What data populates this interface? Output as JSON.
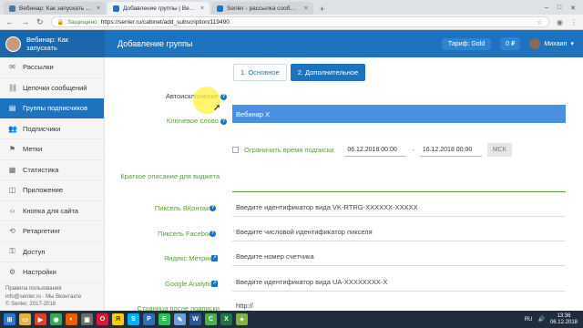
{
  "browser": {
    "tabs": [
      {
        "title": "Вебинар: Как запускать приб...",
        "color": "#1e73be"
      },
      {
        "title": "Добавление группы | Вебина...",
        "color": "#1e73be"
      },
      {
        "title": "Senler - рассылка сообщений",
        "color": "#1e73be"
      }
    ],
    "url": "https://senler.ru/cabinet/add_subscription/119490",
    "url_secure_label": "Защищено"
  },
  "header": {
    "brand_name": "Вебинар: Как запускать",
    "page_title": "Добавление группы",
    "tariff": "Тариф: Gold",
    "balance": "0 ₽",
    "user_name": "Михаил"
  },
  "sidebar": {
    "items": [
      {
        "label": "Рассылки",
        "icon": "mail-icon"
      },
      {
        "label": "Цепочки сообщений",
        "icon": "chain-icon"
      },
      {
        "label": "Группы подписчиков",
        "icon": "folder-icon"
      },
      {
        "label": "Подписчики",
        "icon": "users-icon"
      },
      {
        "label": "Метки",
        "icon": "tag-icon"
      },
      {
        "label": "Статистика",
        "icon": "stats-icon"
      },
      {
        "label": "Приложение",
        "icon": "app-icon"
      },
      {
        "label": "Кнопка для сайта",
        "icon": "code-icon"
      },
      {
        "label": "Ретаргетинг",
        "icon": "retarget-icon"
      },
      {
        "label": "Доступ",
        "icon": "access-icon"
      },
      {
        "label": "Настройки",
        "icon": "gear-icon"
      }
    ],
    "active_index": 2,
    "footer_rules": "Правила пользования",
    "footer_contacts": "info@senler.ru · Мы Вконтакте",
    "footer_copy": "© Senler, 2017-2018"
  },
  "form": {
    "tab_basic": "1. Основное",
    "tab_extra": "2. Дополнительное",
    "auto_exclude_label": "Автоисключение",
    "keyword_label": "Ключевое слово",
    "keyword_value": "Вебинар X",
    "limit_time_label": "Ограничить время подписки",
    "date_from": "06.12.2018 00:00",
    "date_to": "16.12.2018 00:00",
    "timezone": "МСК",
    "short_desc_label": "Краткое описание для виджета",
    "vk_pixel_label": "Пиксель ВКонтакте",
    "vk_pixel_placeholder": "Введите идентификатор вида VK-RTRG-XXXXXX-XXXXX",
    "fb_pixel_label": "Пиксель Facebook",
    "fb_pixel_placeholder": "Введите числовой идентификатор пикселя",
    "ym_label": "Яндекс Метрика",
    "ym_placeholder": "Введите номер счетчика",
    "ga_label": "Google Analytics",
    "ga_placeholder": "Введите идентификатор вида UA-XXXXXXXX-X",
    "after_page_label": "Страница после подписки",
    "after_page_value": "http://"
  },
  "taskbar": {
    "icons": [
      {
        "name": "windows-start-icon",
        "color": "#2b79d0"
      },
      {
        "name": "explorer-icon",
        "color": "#e3b341"
      },
      {
        "name": "media-icon",
        "color": "#d9452b"
      },
      {
        "name": "chrome-icon",
        "color": "#34a853"
      },
      {
        "name": "firefox-icon",
        "color": "#e66000"
      },
      {
        "name": "app-icon",
        "color": "#6d6d6d"
      },
      {
        "name": "opera-icon",
        "color": "#d61b2f"
      },
      {
        "name": "yandex-icon",
        "color": "#ffcc00"
      },
      {
        "name": "skype-icon",
        "color": "#00aff0"
      },
      {
        "name": "photoshop-icon",
        "color": "#2c6fb5"
      },
      {
        "name": "evernote-icon",
        "color": "#2dbe60"
      },
      {
        "name": "notepad-icon",
        "color": "#6aa0d8"
      },
      {
        "name": "word-icon",
        "color": "#2b579a"
      },
      {
        "name": "camtasia-icon",
        "color": "#4caf50"
      },
      {
        "name": "excel-icon",
        "color": "#217346"
      },
      {
        "name": "app2-icon",
        "color": "#7fb342"
      }
    ],
    "lang": "RU",
    "time": "13:36",
    "date": "06.12.2018"
  }
}
